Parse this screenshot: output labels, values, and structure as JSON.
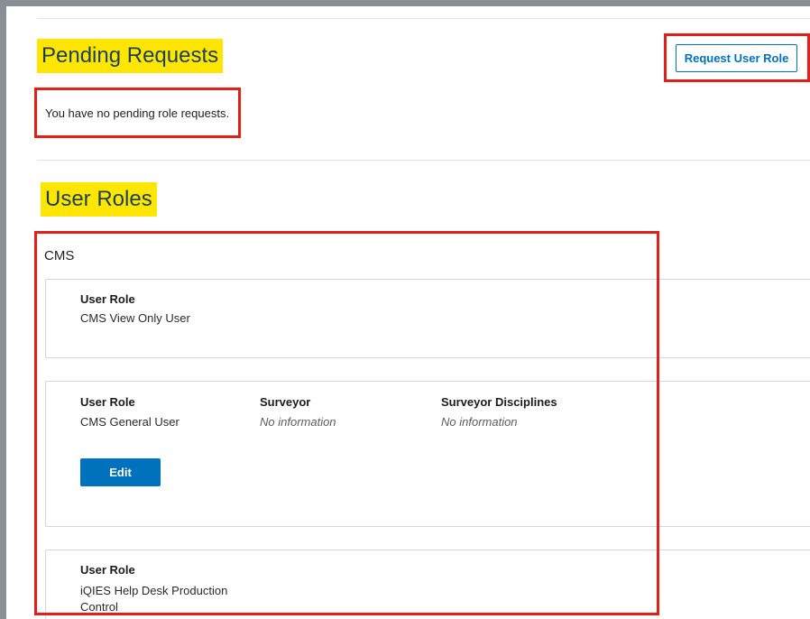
{
  "pending": {
    "title": "Pending Requests",
    "request_button": "Request User Role",
    "empty_message": "You have no pending role requests."
  },
  "user_roles": {
    "title": "User Roles",
    "group_name": "CMS",
    "cards": [
      {
        "role_label": "User Role",
        "role_value": "CMS View Only User"
      },
      {
        "role_label": "User Role",
        "role_value": "CMS General User",
        "surveyor_label": "Surveyor",
        "surveyor_value": "No information",
        "disciplines_label": "Surveyor Disciplines",
        "disciplines_value": "No information",
        "edit_button": "Edit"
      },
      {
        "role_label": "User Role",
        "role_value_line1": "iQIES Help Desk Production",
        "role_value_line2": "Control"
      }
    ]
  },
  "colors": {
    "highlight": "#ffe600",
    "annotation_red": "#e32018",
    "primary_blue": "#0071bc"
  }
}
